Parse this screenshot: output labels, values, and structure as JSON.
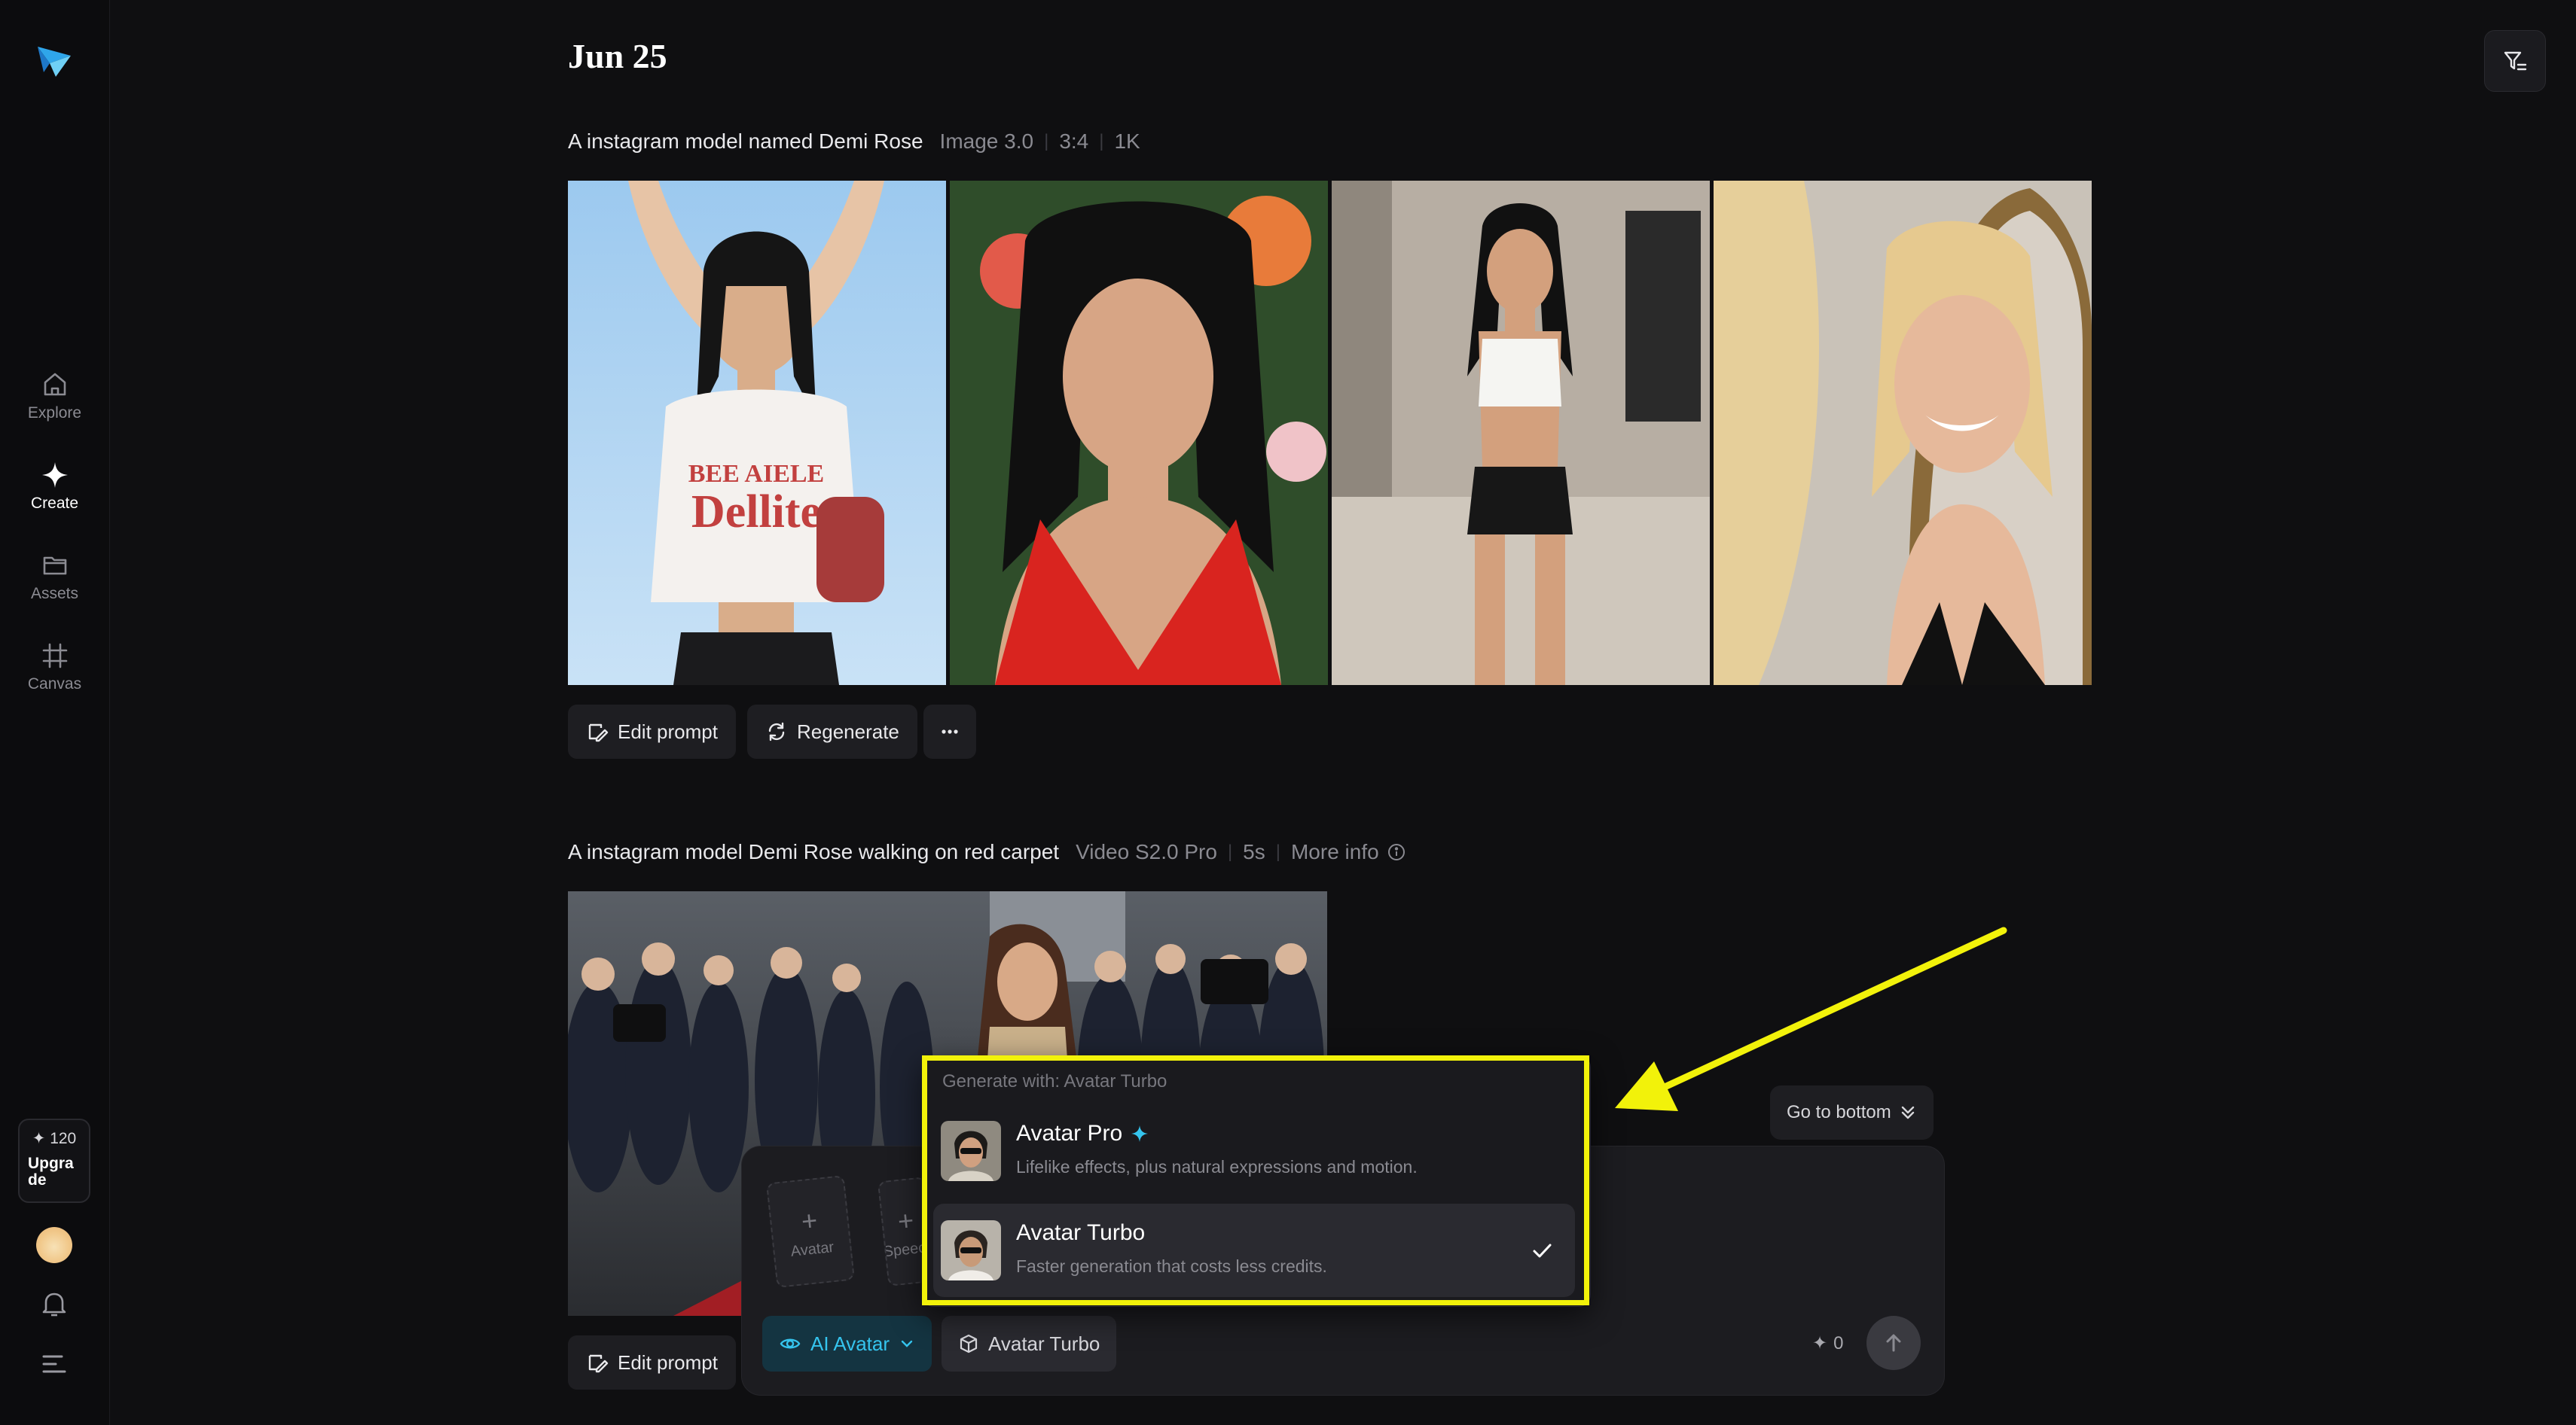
{
  "sidebar": {
    "nav": [
      {
        "label": "Explore",
        "icon": "home-icon"
      },
      {
        "label": "Create",
        "icon": "sparkle-icon"
      },
      {
        "label": "Assets",
        "icon": "folder-icon"
      },
      {
        "label": "Canvas",
        "icon": "frame-icon"
      }
    ],
    "credits": "✦ 120",
    "upgrade_label": "Upgrade"
  },
  "header": {
    "date": "Jun 25"
  },
  "generations": [
    {
      "prompt": "A instagram model named Demi Rose",
      "meta": [
        "Image 3.0",
        "3:4",
        "1K"
      ],
      "actions": {
        "edit": "Edit prompt",
        "regenerate": "Regenerate"
      }
    },
    {
      "prompt": "A instagram model Demi Rose walking on red carpet",
      "meta": [
        "Video S2.0 Pro",
        "5s",
        "More info"
      ],
      "actions": {
        "edit": "Edit prompt"
      }
    }
  ],
  "go_to_bottom": "Go to bottom",
  "composer": {
    "slots": [
      {
        "label": "Avatar"
      },
      {
        "label": "Speech"
      }
    ],
    "mode_label": "AI Avatar",
    "model_label": "Avatar Turbo",
    "cost": "0"
  },
  "dropdown": {
    "header": "Generate with: Avatar Turbo",
    "items": [
      {
        "name": "Avatar Pro",
        "desc": "Lifelike effects, plus natural expressions and motion.",
        "selected": false
      },
      {
        "name": "Avatar Turbo",
        "desc": "Faster generation that costs less credits.",
        "selected": true
      }
    ]
  },
  "colors": {
    "accent": "#35c4ee",
    "highlight": "#f2f20a",
    "background": "#0f0f11"
  }
}
